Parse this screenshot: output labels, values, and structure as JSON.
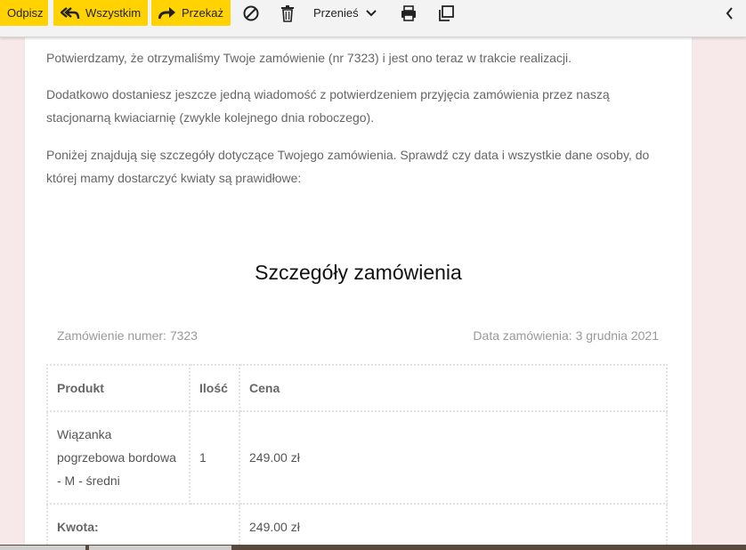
{
  "toolbar": {
    "reply_label": "Odpisz",
    "reply_all_label": "Wszystkim",
    "forward_label": "Przekaż",
    "move_label": "Przenieś",
    "accent": "#ffd200"
  },
  "email": {
    "paragraph1": "Potwierdzamy, że otrzymaliśmy Twoje zamówienie (nr 7323) i jest ono teraz w trakcie realizacji.",
    "paragraph2": "Dodatkowo dostaniesz jeszcze jedną wiadomość z potwierdzeniem przyjęcia zamówienia przez naszą stacjonarną kwiaciarnię (zwykle kolejnego dnia roboczego).",
    "paragraph3": "Poniżej znajdują się szczegóły dotyczące Twojego zamówienia. Sprawdź czy data i wszystkie dane osoby, do której mamy dostarczyć kwiaty są prawidłowe:",
    "details_title": "Szczegóły zamówienia",
    "order_number": "Zamówienie numer: 7323",
    "order_date": "Data zamówienia: 3 grudnia 2021"
  },
  "table": {
    "headers": [
      "Produkt",
      "Ilość",
      "Cena"
    ],
    "rows": [
      {
        "product": "Wiązanka pogrzebowa bordowa - M - średni",
        "qty": "1",
        "price": "249.00 zł"
      }
    ],
    "total_label": "Kwota:",
    "total_value": "249.00 zł"
  }
}
